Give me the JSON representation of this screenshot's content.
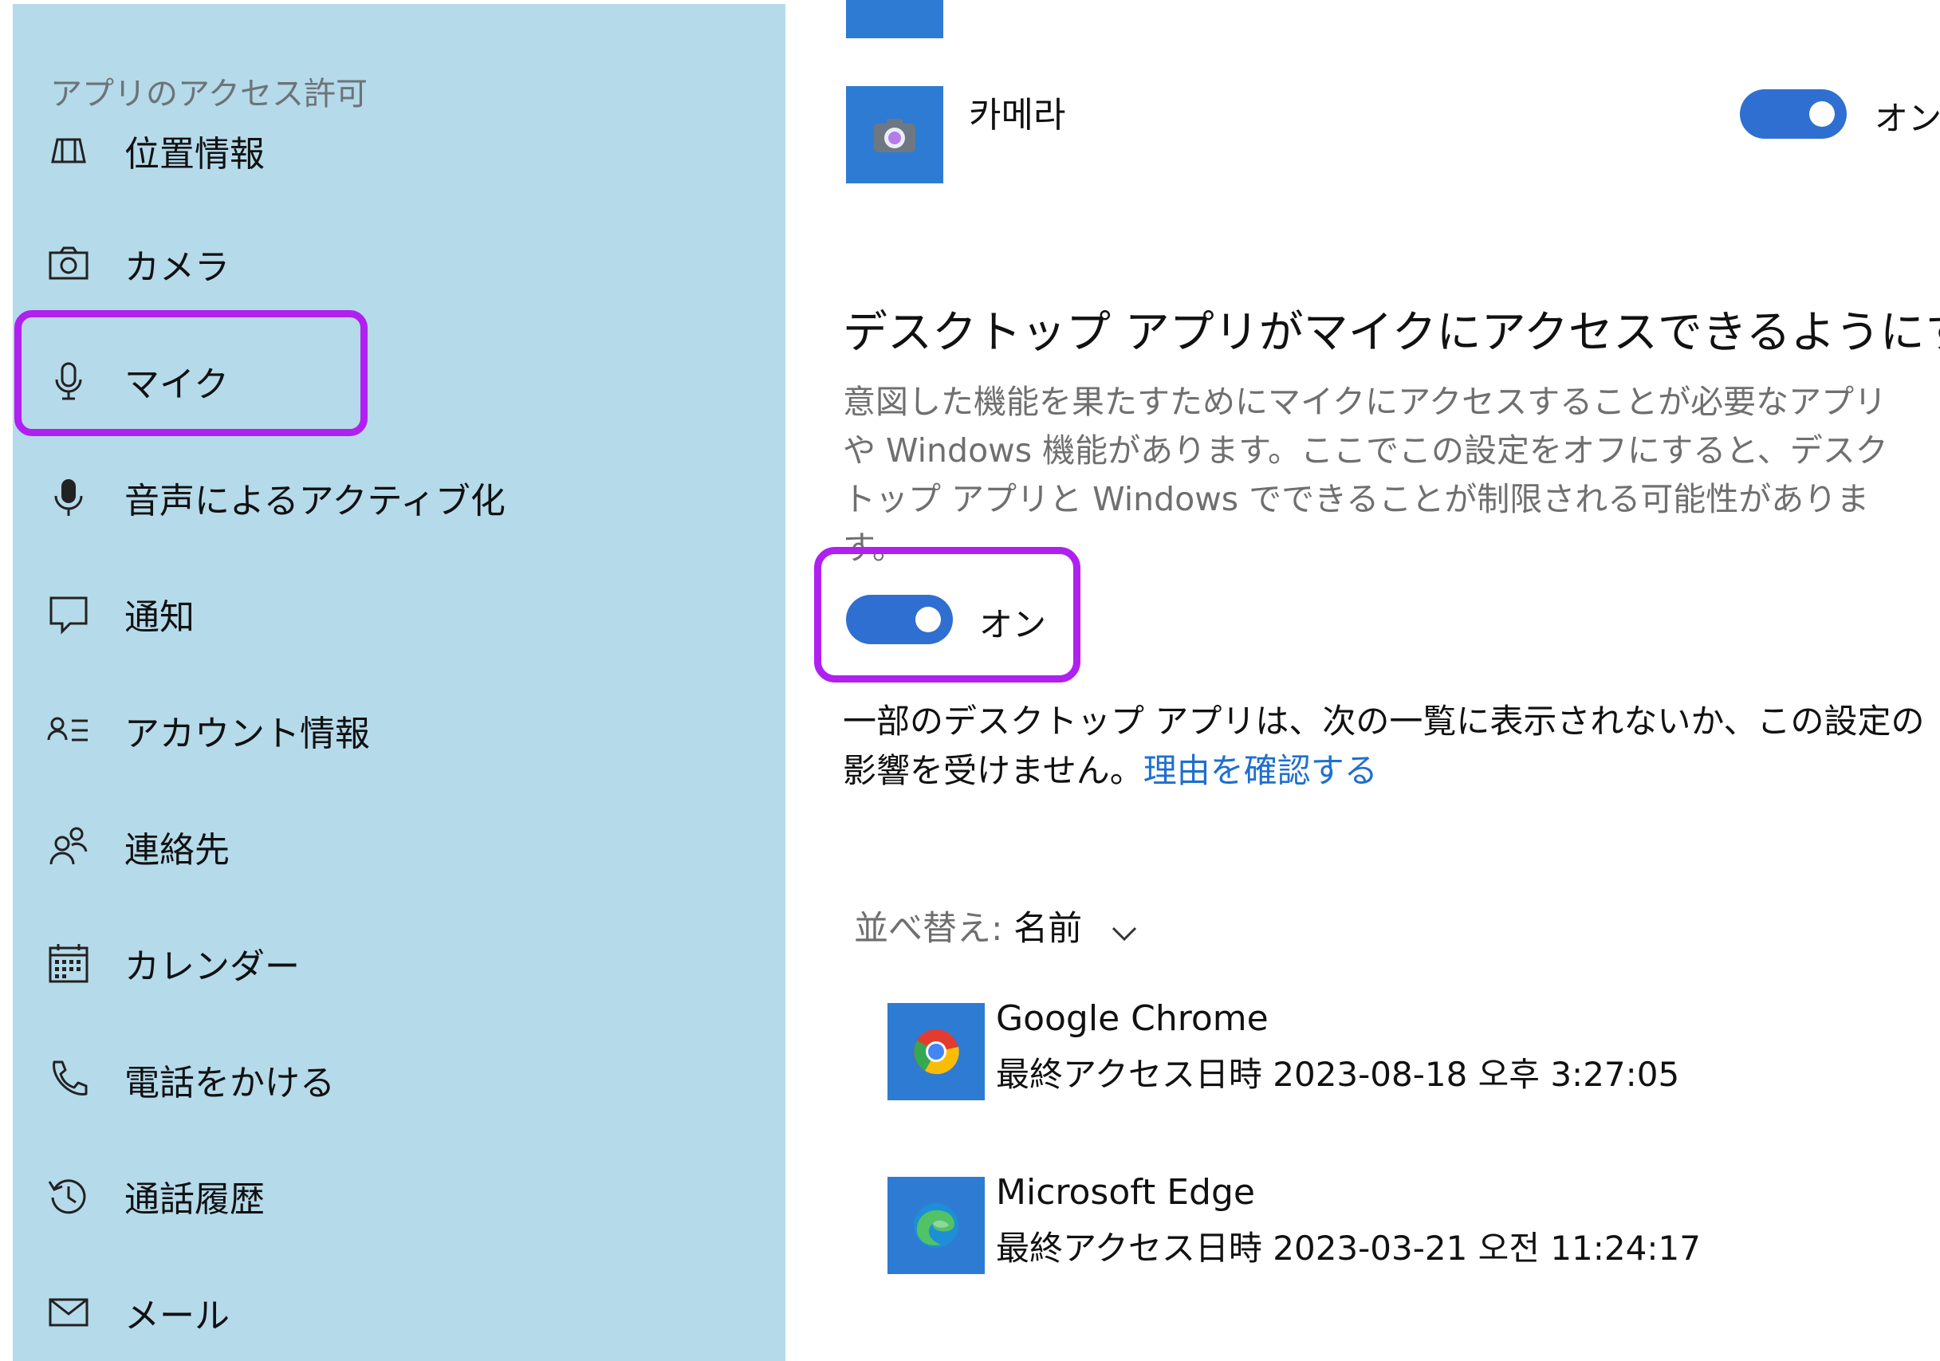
{
  "sidebar": {
    "title": "アプリのアクセス許可",
    "items": [
      {
        "label": "位置情報",
        "icon": "location-icon"
      },
      {
        "label": "カメラ",
        "icon": "camera-icon"
      },
      {
        "label": "マイク",
        "icon": "microphone-icon",
        "selected": true
      },
      {
        "label": "音声によるアクティブ化",
        "icon": "voice-activation-icon"
      },
      {
        "label": "通知",
        "icon": "notification-icon"
      },
      {
        "label": "アカウント情報",
        "icon": "account-info-icon"
      },
      {
        "label": "連絡先",
        "icon": "contacts-icon"
      },
      {
        "label": "カレンダー",
        "icon": "calendar-icon"
      },
      {
        "label": "電話をかける",
        "icon": "phone-icon"
      },
      {
        "label": "通話履歴",
        "icon": "call-history-icon"
      },
      {
        "label": "メール",
        "icon": "mail-icon"
      }
    ]
  },
  "main": {
    "camera_app": {
      "name": "카메라",
      "toggle_state": "オン",
      "enabled": true,
      "icon": "camera-app-icon"
    },
    "desktop_section": {
      "heading": "デスクトップ アプリがマイクにアクセスできるようにする",
      "description": "意図した機能を果たすためにマイクにアクセスすることが必要なアプリや Windows 機能があります。ここでこの設定をオフにすると、デスクトップ アプリと Windows でできることが制限される可能性があります。",
      "toggle_state": "オン",
      "enabled": true,
      "note": "一部のデスクトップ アプリは、次の一覧に表示されないか、この設定の影響を受けません。",
      "note_link": "理由を確認する"
    },
    "sort": {
      "label": "並べ替え:",
      "value": "名前",
      "icon": "chevron-down-icon"
    },
    "apps": [
      {
        "name": "Google Chrome",
        "last_access": "最終アクセス日時 2023-08-18 오후 3:27:05",
        "icon": "chrome-icon"
      },
      {
        "name": "Microsoft Edge",
        "last_access": "最終アクセス日時 2023-03-21 오전 11:24:17",
        "icon": "edge-icon"
      }
    ]
  },
  "colors": {
    "sidebar_bg": "#b5daea",
    "accent": "#2f6fd1",
    "highlight": "#b020f0",
    "link": "#1f6fd0"
  }
}
